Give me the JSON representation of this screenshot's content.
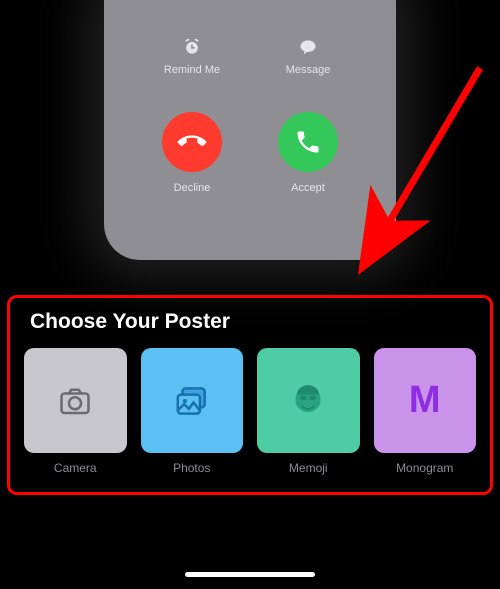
{
  "call_screen": {
    "remind": {
      "label": "Remind Me"
    },
    "message": {
      "label": "Message"
    },
    "decline": {
      "label": "Decline"
    },
    "accept": {
      "label": "Accept"
    }
  },
  "poster": {
    "title": "Choose Your Poster",
    "options": {
      "camera": {
        "label": "Camera"
      },
      "photos": {
        "label": "Photos"
      },
      "memoji": {
        "label": "Memoji"
      },
      "monogram": {
        "label": "Monogram",
        "letter": "M"
      }
    }
  }
}
